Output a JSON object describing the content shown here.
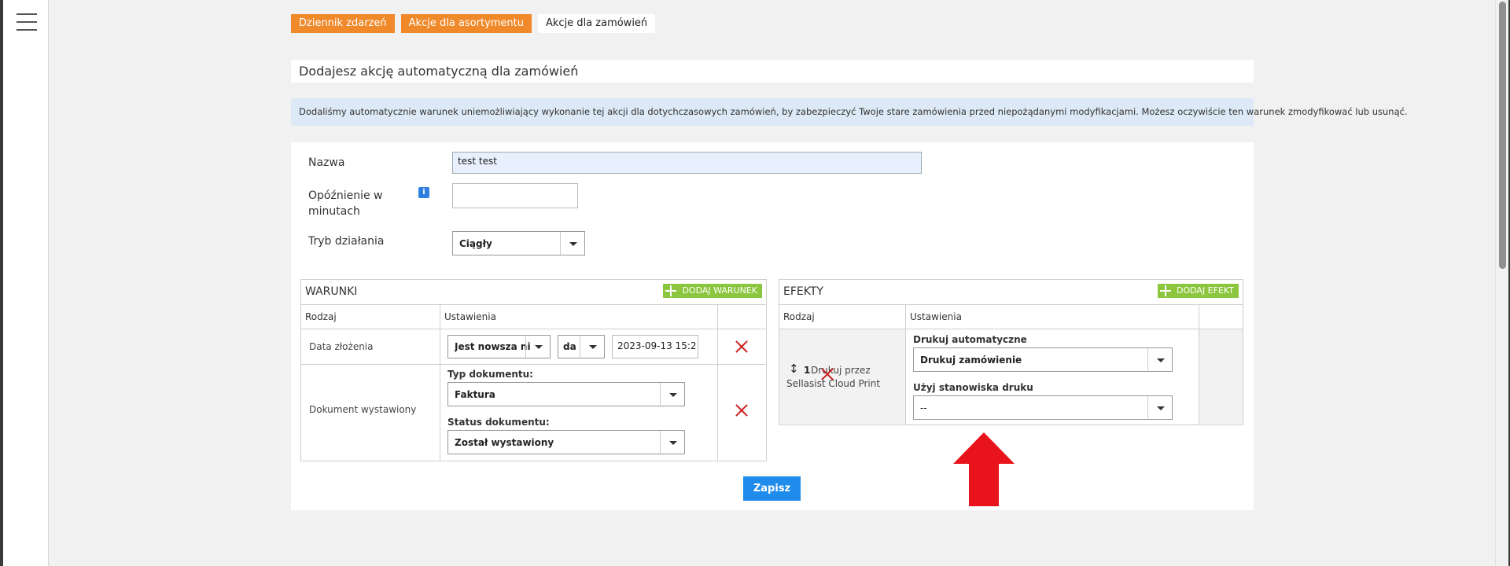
{
  "tabs": [
    {
      "label": "Dziennik zdarzeń"
    },
    {
      "label": "Akcje dla asortymentu"
    },
    {
      "label": "Akcje dla zamówień"
    }
  ],
  "heading": "Dodajesz akcję automatyczną dla zamówień",
  "info_message": "Dodaliśmy automatycznie warunek uniemożliwiający wykonanie tej akcji dla dotychczasowych zamówień, by zabezpieczyć Twoje stare zamówienia przed niepożądanymi modyfikacjami. Możesz oczywiście ten warunek zmodyfikować lub usunąć.",
  "form": {
    "name_label": "Nazwa",
    "name_value": "test test",
    "delay_label": "Opóźnienie w minutach",
    "delay_info": "i",
    "delay_value": "",
    "mode_label": "Tryb działania",
    "mode_value": "Ciągły"
  },
  "conditions": {
    "title": "WARUNKI",
    "add_label": "DODAJ WARUNEK",
    "col_type": "Rodzaj",
    "col_settings": "Ustawienia",
    "rows": [
      {
        "type": "Data złożenia",
        "op": "Jest nowsza ni",
        "unit": "da",
        "date": "2023-09-13 15:2"
      },
      {
        "type": "Dokument wystawiony",
        "doc_type_label": "Typ dokumentu:",
        "doc_type": "Faktura",
        "doc_status_label": "Status dokumentu:",
        "doc_status": "Został wystawiony"
      }
    ]
  },
  "effects": {
    "title": "EFEKTY",
    "add_label": "DODAJ EFEKT",
    "col_type": "Rodzaj",
    "col_settings": "Ustawienia",
    "rows": [
      {
        "order": "1",
        "type_line1": "Drukuj przez",
        "type_line2": "Sellasist Cloud Print",
        "print_label": "Drukuj automatyczne",
        "print_value": "Drukuj zamówienie",
        "station_label": "Użyj stanowiska druku",
        "station_value": "--"
      }
    ]
  },
  "save_label": "Zapisz",
  "colors": {
    "accent_orange": "#f0892a",
    "save_blue": "#1f8ceb",
    "add_green": "#8cc63f",
    "delete_red": "#cc1f1f",
    "arrow_red": "#e8131b"
  }
}
